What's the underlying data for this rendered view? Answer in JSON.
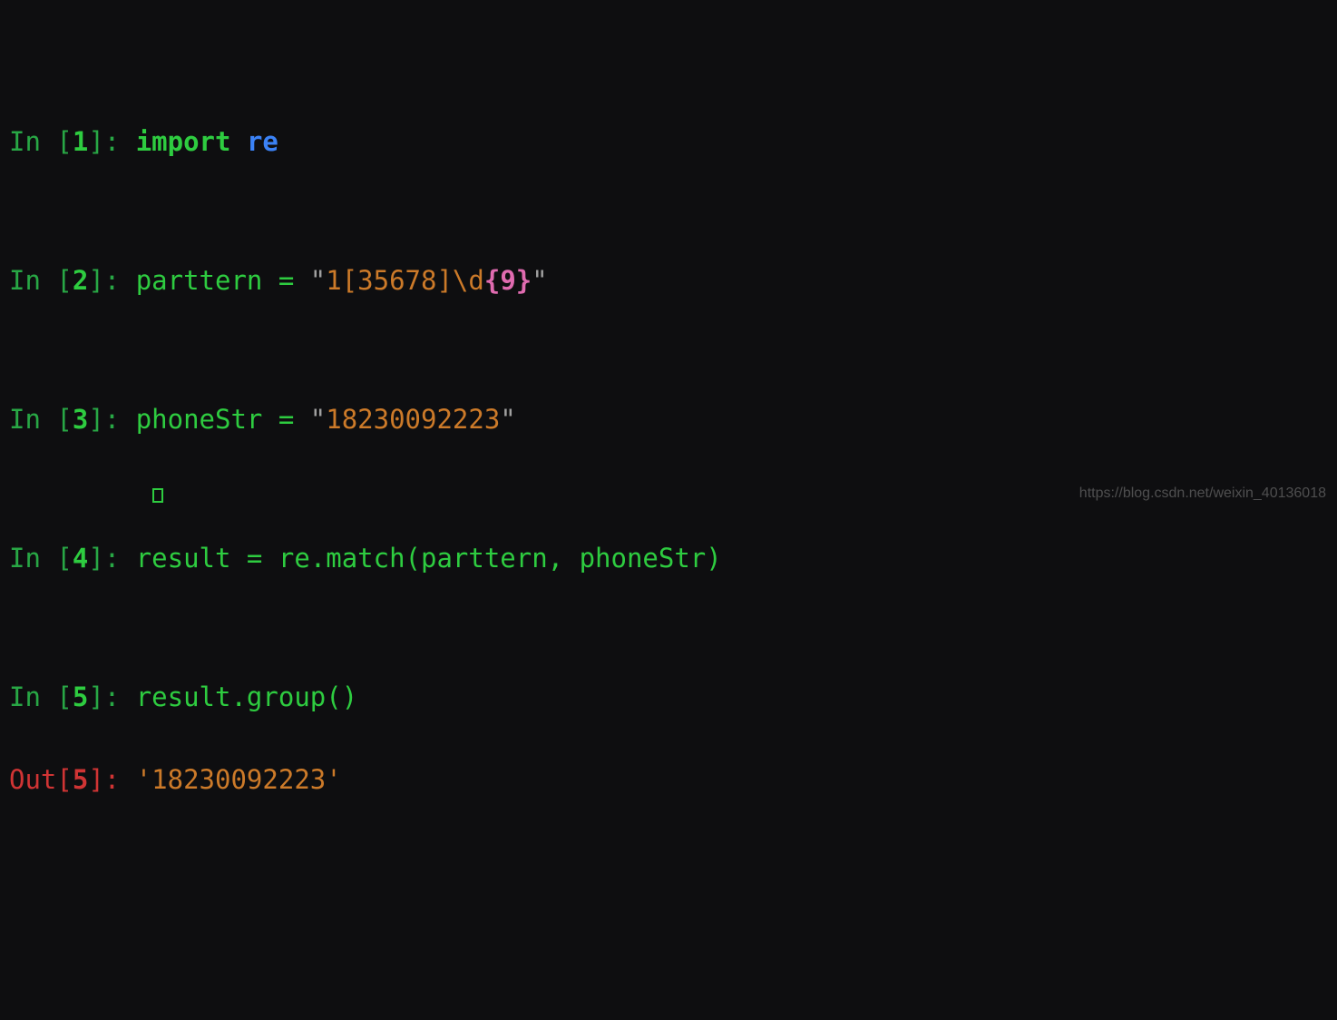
{
  "prompt": {
    "in": "In ",
    "out": "Out",
    "lb": "[",
    "rb": "]",
    "colon": ": "
  },
  "cells": {
    "c1": {
      "n": "1",
      "kw_import": "import ",
      "mod": "re"
    },
    "c2": {
      "n": "2",
      "var": "parttern ",
      "eq": "= ",
      "q1": "\"",
      "s1": "1[35678]\\d",
      "br_l": "{",
      "br_n": "9",
      "br_r": "}",
      "q2": "\""
    },
    "c3": {
      "n": "3",
      "var": "phoneStr ",
      "eq": "= ",
      "q1": "\"",
      "s1": "18230092223",
      "q2": "\""
    },
    "c4": {
      "n": "4",
      "code": "result = re.match(parttern, phoneStr)"
    },
    "c5": {
      "n": "5",
      "code": "result.group()",
      "out_n": "5",
      "out_val": "'18230092223'"
    }
  },
  "watermark": "https://blog.csdn.net/weixin_40136018"
}
